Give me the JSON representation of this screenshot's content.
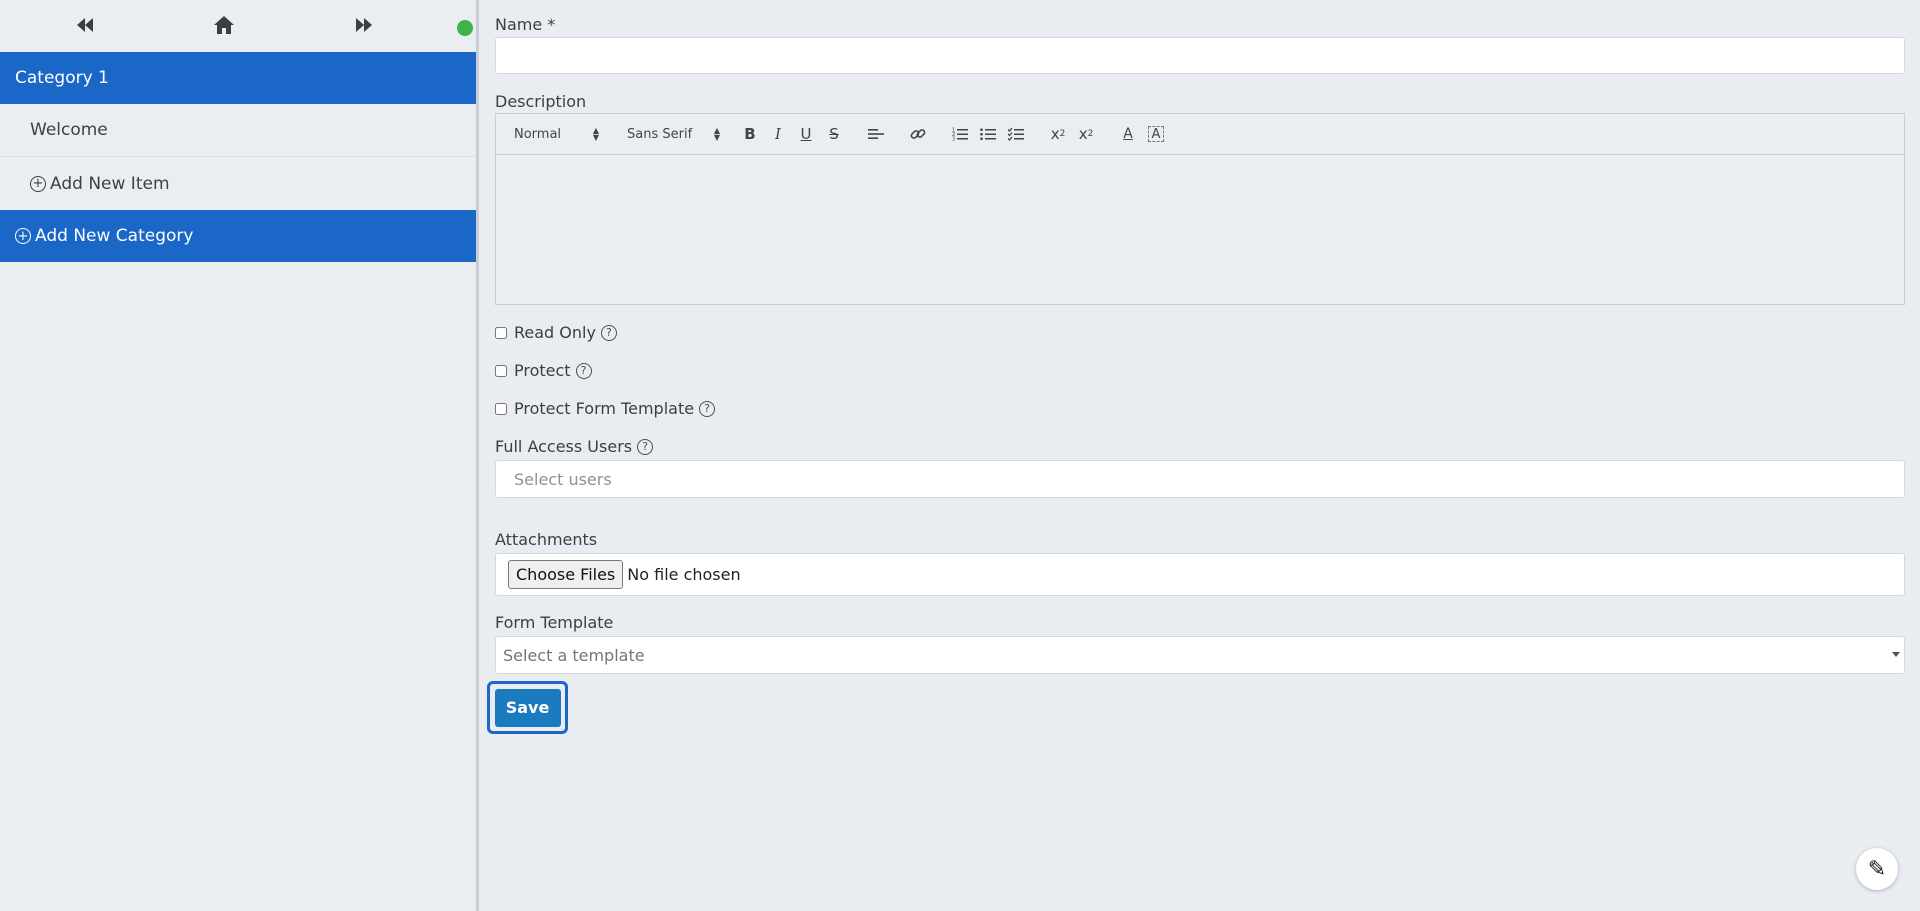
{
  "sidebar": {
    "nav": {
      "back_icon": "rewind-icon",
      "home_icon": "home-icon",
      "forward_icon": "fast-forward-icon"
    },
    "status_color": "#3db34a",
    "category": {
      "label": "Category 1"
    },
    "items": [
      {
        "label": "Welcome"
      },
      {
        "label": "Add New Item"
      }
    ],
    "add_category": {
      "label": "Add New Category"
    }
  },
  "form": {
    "name": {
      "label": "Name *",
      "value": ""
    },
    "description": {
      "label": "Description",
      "toolbar": {
        "size": "Normal",
        "font": "Sans Serif"
      }
    },
    "checkboxes": [
      {
        "label": "Read Only",
        "checked": false
      },
      {
        "label": "Protect",
        "checked": false
      },
      {
        "label": "Protect Form Template",
        "checked": false
      }
    ],
    "full_access": {
      "label": "Full Access Users",
      "placeholder": "Select users"
    },
    "attachments": {
      "label": "Attachments",
      "button": "Choose Files",
      "status": "No file chosen"
    },
    "template": {
      "label": "Form Template",
      "placeholder": "Select a template"
    },
    "save_label": "Save"
  },
  "colors": {
    "primary": "#1a67c8",
    "save": "#1a7bbf",
    "background": "#e9edf2"
  }
}
